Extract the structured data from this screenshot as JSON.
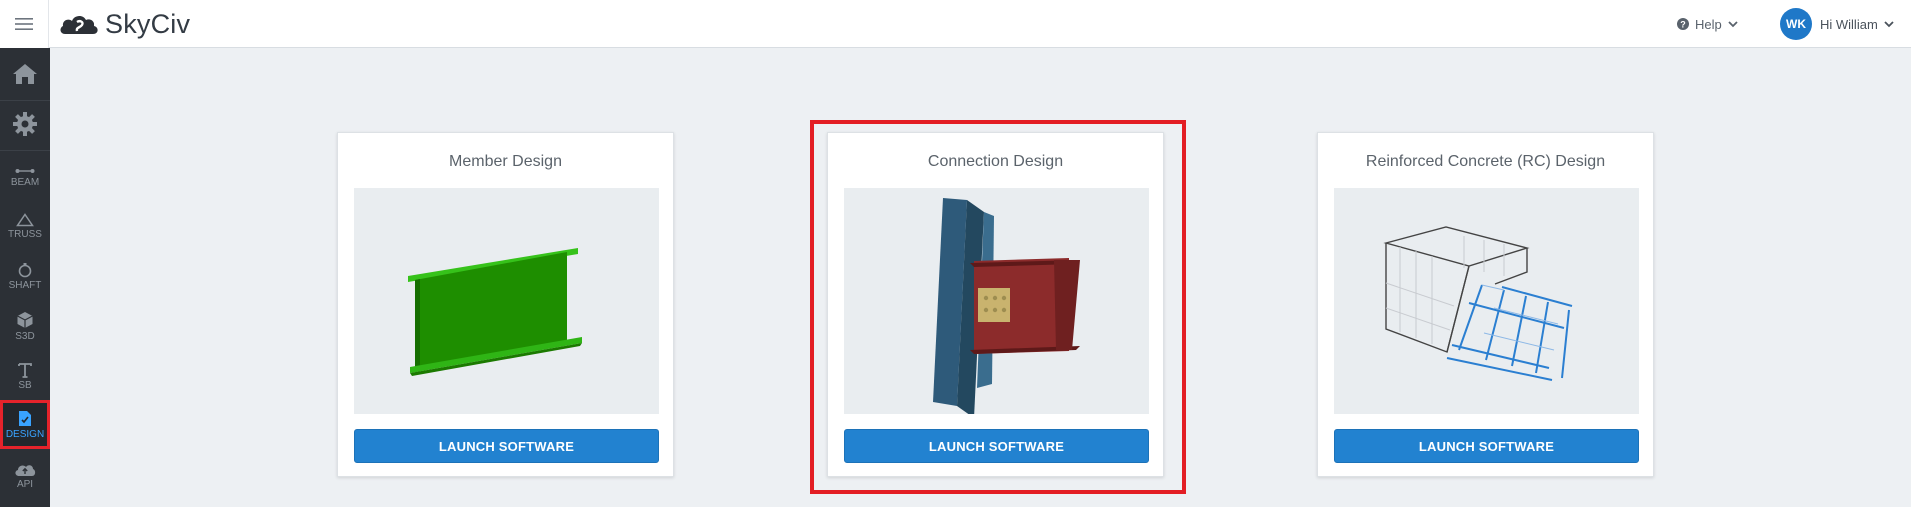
{
  "app": {
    "logo_text": "SkyCiv"
  },
  "header": {
    "help_label": "Help",
    "user_initials": "WK",
    "user_greeting": "Hi William"
  },
  "sidebar": {
    "items": [
      {
        "id": "home",
        "label": "",
        "icon": "home-icon"
      },
      {
        "id": "settings",
        "label": "",
        "icon": "gear-icon"
      },
      {
        "id": "beam",
        "label": "BEAM",
        "icon": "beam-icon"
      },
      {
        "id": "truss",
        "label": "TRUSS",
        "icon": "triangle-icon"
      },
      {
        "id": "shaft",
        "label": "SHAFT",
        "icon": "shaft-icon"
      },
      {
        "id": "s3d",
        "label": "S3D",
        "icon": "cube-icon"
      },
      {
        "id": "sb",
        "label": "SB",
        "icon": "text-t-icon"
      },
      {
        "id": "design",
        "label": "DESIGN",
        "icon": "document-check-icon",
        "active": true
      },
      {
        "id": "api",
        "label": "API",
        "icon": "cloud-icon"
      }
    ]
  },
  "cards": [
    {
      "title": "Member Design",
      "button": "LAUNCH SOFTWARE"
    },
    {
      "title": "Connection Design",
      "button": "LAUNCH SOFTWARE",
      "highlighted": true
    },
    {
      "title": "Reinforced Concrete (RC) Design",
      "button": "LAUNCH SOFTWARE"
    }
  ],
  "colors": {
    "accent": "#2282d0",
    "highlight": "#e31e24",
    "sidebar_bg": "#2c3036",
    "active_label": "#39a3ff"
  }
}
